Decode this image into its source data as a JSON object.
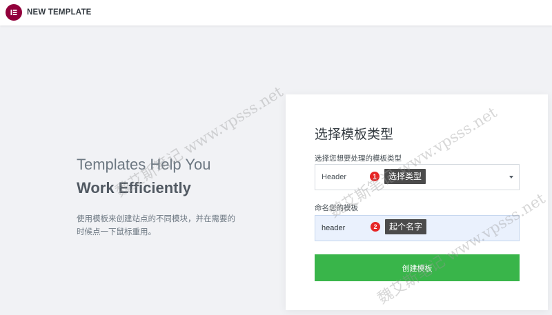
{
  "header": {
    "app_title": "NEW TEMPLATE",
    "logo_icon": "elementor-logo-icon",
    "logo_color": "#92003b"
  },
  "intro": {
    "heading_line1": "Templates Help You",
    "heading_line2": "Work Efficiently",
    "description": "使用模板来创建站点的不同模块，并在需要的时候点一下鼠标重用。"
  },
  "form": {
    "title": "选择模板类型",
    "type_label": "选择您想要处理的模板类型",
    "type_selected": "Header",
    "name_label": "命名您的模板",
    "name_value": "header",
    "create_button_label": "创建模板",
    "button_color": "#39b54a"
  },
  "annotations": [
    {
      "number": "1",
      "text": "选择类型"
    },
    {
      "number": "2",
      "text": "起个名字"
    }
  ],
  "watermark": {
    "text": "魏艾斯笔记 www.vpsss.net"
  }
}
